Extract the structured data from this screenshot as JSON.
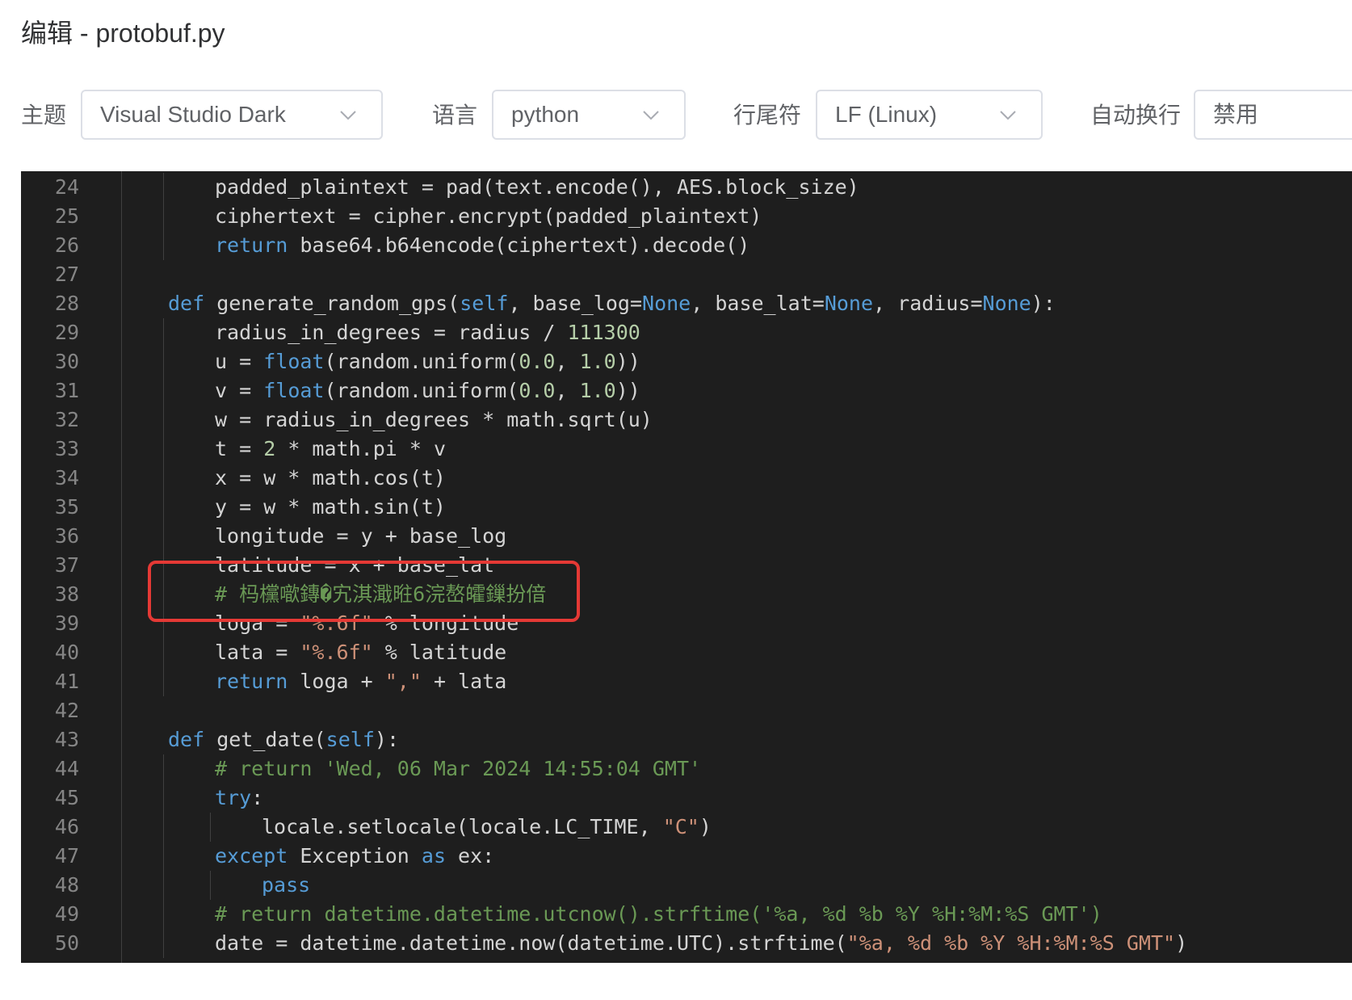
{
  "window": {
    "title": "编辑 - protobuf.py"
  },
  "toolbar": {
    "theme_label": "主题",
    "theme_value": "Visual Studio Dark",
    "language_label": "语言",
    "language_value": "python",
    "eol_label": "行尾符",
    "eol_value": "LF (Linux)",
    "wrap_label": "自动换行",
    "wrap_value": "禁用"
  },
  "colors": {
    "editor_bg": "#1e1e1e",
    "keyword": "#569cd6",
    "number": "#b5cea8",
    "string": "#ce9178",
    "comment": "#6a9955",
    "highlight_border": "#e53935"
  },
  "icons": {
    "dropdown": "chevron-down-icon"
  },
  "editor": {
    "lines": [
      {
        "n": "24",
        "indent": 2,
        "t": [
          [
            "",
            "padded_plaintext = pad(text.encode(), AES.block_size)"
          ]
        ]
      },
      {
        "n": "25",
        "indent": 2,
        "t": [
          [
            "",
            "ciphertext = cipher.encrypt(padded_plaintext)"
          ]
        ]
      },
      {
        "n": "26",
        "indent": 2,
        "t": [
          [
            "kw",
            "return"
          ],
          [
            "",
            " base64.b64encode(ciphertext).decode()"
          ]
        ]
      },
      {
        "n": "27",
        "indent": 0,
        "t": []
      },
      {
        "n": "28",
        "indent": 1,
        "t": [
          [
            "kw",
            "def"
          ],
          [
            "",
            " generate_random_gps("
          ],
          [
            "kw",
            "self"
          ],
          [
            "",
            ", base_log="
          ],
          [
            "kw",
            "None"
          ],
          [
            "",
            ", base_lat="
          ],
          [
            "kw",
            "None"
          ],
          [
            "",
            ", radius="
          ],
          [
            "kw",
            "None"
          ],
          [
            "",
            "):"
          ]
        ]
      },
      {
        "n": "29",
        "indent": 2,
        "t": [
          [
            "",
            "radius_in_degrees = radius / "
          ],
          [
            "num",
            "111300"
          ]
        ]
      },
      {
        "n": "30",
        "indent": 2,
        "t": [
          [
            "",
            "u = "
          ],
          [
            "kw",
            "float"
          ],
          [
            "",
            "(random.uniform("
          ],
          [
            "num",
            "0.0"
          ],
          [
            "",
            ", "
          ],
          [
            "num",
            "1.0"
          ],
          [
            "",
            "))"
          ]
        ]
      },
      {
        "n": "31",
        "indent": 2,
        "t": [
          [
            "",
            "v = "
          ],
          [
            "kw",
            "float"
          ],
          [
            "",
            "(random.uniform("
          ],
          [
            "num",
            "0.0"
          ],
          [
            "",
            ", "
          ],
          [
            "num",
            "1.0"
          ],
          [
            "",
            "))"
          ]
        ]
      },
      {
        "n": "32",
        "indent": 2,
        "t": [
          [
            "",
            "w = radius_in_degrees * math.sqrt(u)"
          ]
        ]
      },
      {
        "n": "33",
        "indent": 2,
        "t": [
          [
            "",
            "t = "
          ],
          [
            "num",
            "2"
          ],
          [
            "",
            " * math.pi * v"
          ]
        ]
      },
      {
        "n": "34",
        "indent": 2,
        "t": [
          [
            "",
            "x = w * math.cos(t)"
          ]
        ]
      },
      {
        "n": "35",
        "indent": 2,
        "t": [
          [
            "",
            "y = w * math.sin(t)"
          ]
        ]
      },
      {
        "n": "36",
        "indent": 2,
        "t": [
          [
            "",
            "longitude = y + base_log"
          ]
        ]
      },
      {
        "n": "37",
        "indent": 2,
        "t": [
          [
            "",
            "latitude = x + base_lat"
          ]
        ]
      },
      {
        "n": "38",
        "indent": 2,
        "t": [
          [
            "cm",
            "# 杩欓噷鏄�宄淇濈暀6浣嶅皬鏁扮偣"
          ]
        ]
      },
      {
        "n": "39",
        "indent": 2,
        "t": [
          [
            "",
            "loga = "
          ],
          [
            "str",
            "\"%.6f\""
          ],
          [
            "",
            " % longitude"
          ]
        ]
      },
      {
        "n": "40",
        "indent": 2,
        "t": [
          [
            "",
            "lata = "
          ],
          [
            "str",
            "\"%.6f\""
          ],
          [
            "",
            " % latitude"
          ]
        ]
      },
      {
        "n": "41",
        "indent": 2,
        "t": [
          [
            "kw",
            "return"
          ],
          [
            "",
            " loga + "
          ],
          [
            "str",
            "\",\""
          ],
          [
            "",
            " + lata"
          ]
        ]
      },
      {
        "n": "42",
        "indent": 0,
        "t": []
      },
      {
        "n": "43",
        "indent": 1,
        "t": [
          [
            "kw",
            "def"
          ],
          [
            "",
            " get_date("
          ],
          [
            "kw",
            "self"
          ],
          [
            "",
            "):"
          ]
        ]
      },
      {
        "n": "44",
        "indent": 2,
        "t": [
          [
            "cm",
            "# return 'Wed, 06 Mar 2024 14:55:04 GMT'"
          ]
        ]
      },
      {
        "n": "45",
        "indent": 2,
        "t": [
          [
            "kw",
            "try"
          ],
          [
            "",
            ":"
          ]
        ]
      },
      {
        "n": "46",
        "indent": 3,
        "t": [
          [
            "",
            "locale.setlocale(locale.LC_TIME, "
          ],
          [
            "str",
            "\"C\""
          ],
          [
            "",
            ")"
          ]
        ]
      },
      {
        "n": "47",
        "indent": 2,
        "t": [
          [
            "kw",
            "except"
          ],
          [
            "",
            " Exception "
          ],
          [
            "kw",
            "as"
          ],
          [
            "",
            " ex:"
          ]
        ]
      },
      {
        "n": "48",
        "indent": 3,
        "t": [
          [
            "kw",
            "pass"
          ]
        ]
      },
      {
        "n": "49",
        "indent": 2,
        "t": [
          [
            "cm",
            "# return datetime.datetime.utcnow().strftime('%a, %d %b %Y %H:%M:%S GMT')"
          ]
        ]
      },
      {
        "n": "50",
        "indent": 2,
        "t": [
          [
            "",
            "date = datetime.datetime.now(datetime.UTC).strftime("
          ],
          [
            "str",
            "\"%a, %d %b %Y %H:%M:%S GMT\""
          ],
          [
            "",
            ")"
          ]
        ]
      }
    ]
  }
}
